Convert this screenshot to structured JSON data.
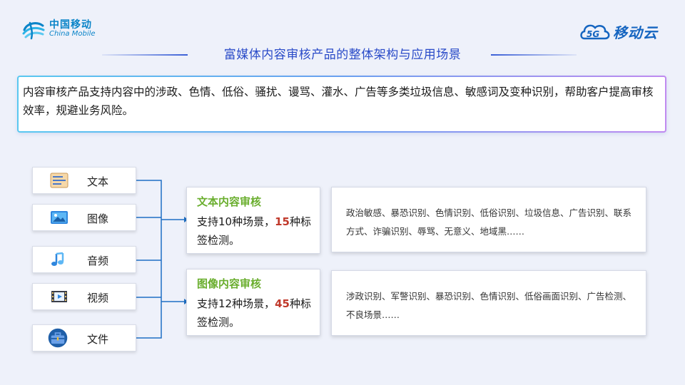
{
  "brand": {
    "logo_cn": "中国移动",
    "logo_en": "China Mobile",
    "cloud_badge": "5G",
    "cloud_name": "移动云",
    "accent": "#2a4bc8"
  },
  "title": "富媒体内容审核产品的整体架构与应用场景",
  "intro": "内容审核产品支持内容中的涉政、色情、低俗、骚扰、谩骂、灌水、广告等多类垃圾信息、敏感词及变种识别，帮助客户提高审核效率，规避业务风险。",
  "content_types": [
    {
      "label": "文本",
      "icon": "text-document-icon"
    },
    {
      "label": "图像",
      "icon": "image-icon"
    },
    {
      "label": "音频",
      "icon": "music-note-icon"
    },
    {
      "label": "视频",
      "icon": "video-film-icon"
    },
    {
      "label": "文件",
      "icon": "file-briefcase-icon"
    }
  ],
  "audits": [
    {
      "title": "文本内容审核",
      "desc_prefix": "支持",
      "scene_count": "10",
      "desc_mid": "种场景，",
      "label_count": "15",
      "desc_suffix": "种标签检测。",
      "scenes": "政治敏感、暴恐识别、色情识别、低俗识别、垃圾信息、广告识别、联系方式、诈骗识别、辱骂、无意义、地域黑……"
    },
    {
      "title": "图像内容审核",
      "desc_prefix": "支持",
      "scene_count": "12",
      "desc_mid": "种场景，",
      "label_count": "45",
      "desc_suffix": "种标签检测。",
      "scenes": "涉政识别、军警识别、暴恐识别、色情识别、低俗画面识别、广告检测、不良场景……"
    }
  ]
}
